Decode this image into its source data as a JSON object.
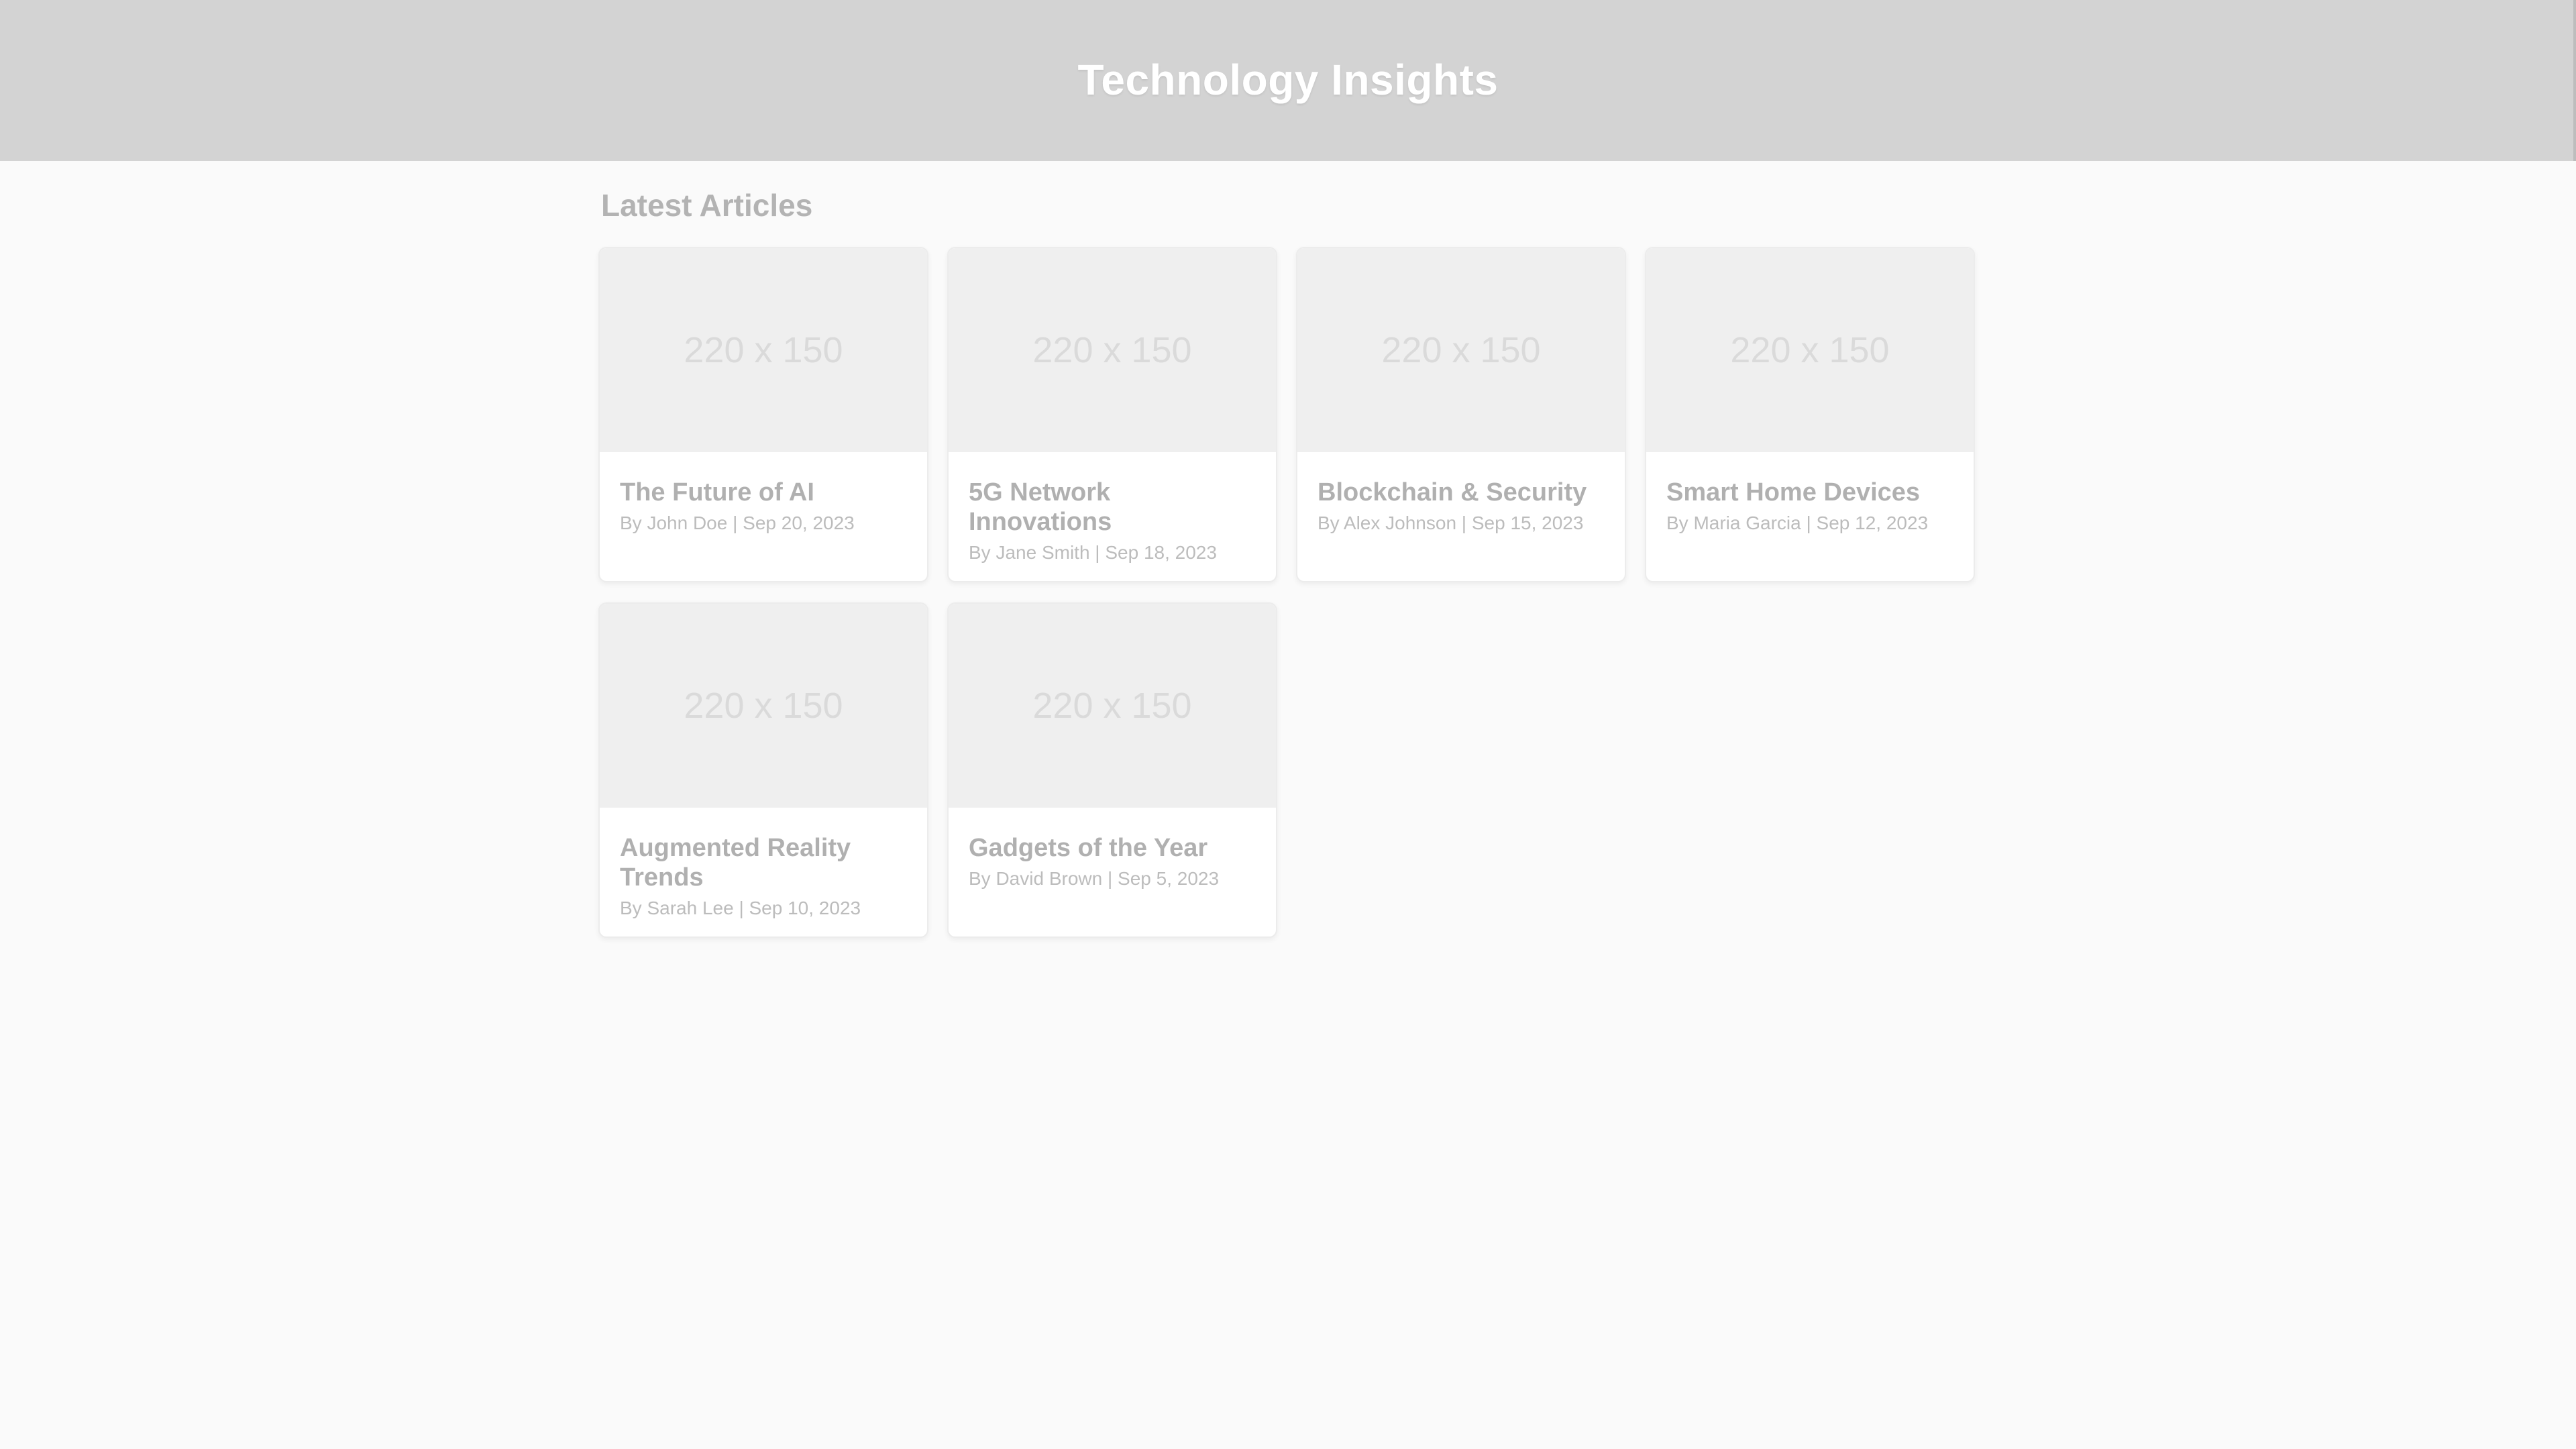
{
  "header": {
    "title": "Technology Insights"
  },
  "main": {
    "section_title": "Latest Articles",
    "articles": [
      {
        "image_label": "220 x 150",
        "title": "The Future of AI",
        "meta": "By John Doe | Sep 20, 2023"
      },
      {
        "image_label": "220 x 150",
        "title": "5G Network Innovations",
        "meta": "By Jane Smith | Sep 18, 2023"
      },
      {
        "image_label": "220 x 150",
        "title": "Blockchain & Security",
        "meta": "By Alex Johnson | Sep 15, 2023"
      },
      {
        "image_label": "220 x 150",
        "title": "Smart Home Devices",
        "meta": "By Maria Garcia | Sep 12, 2023"
      },
      {
        "image_label": "220 x 150",
        "title": "Augmented Reality Trends",
        "meta": "By Sarah Lee | Sep 10, 2023"
      },
      {
        "image_label": "220 x 150",
        "title": "Gadgets of the Year",
        "meta": "By David Brown | Sep 5, 2023"
      }
    ]
  },
  "colors": {
    "header_background": "#d3d3d3",
    "page_background": "#fafafa",
    "card_background": "#ffffff",
    "image_placeholder": "#efefef"
  }
}
